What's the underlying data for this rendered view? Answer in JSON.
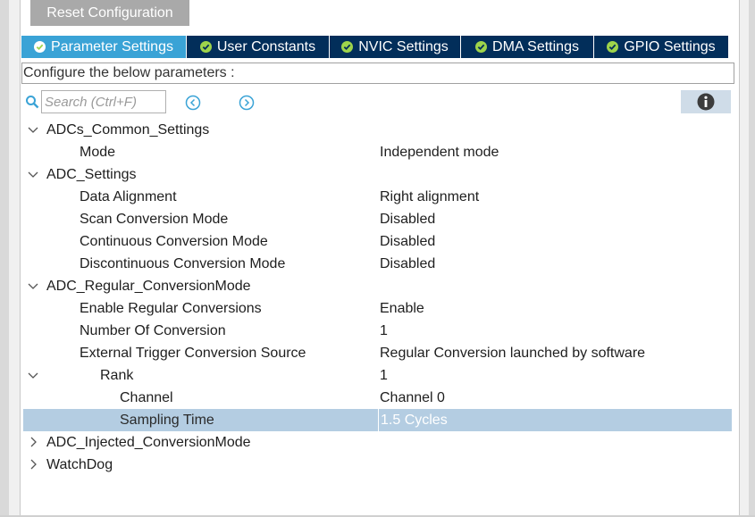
{
  "toolbar": {
    "reset_label": "Reset Configuration"
  },
  "tabs": [
    {
      "label": "Parameter Settings",
      "active": true
    },
    {
      "label": "User Constants",
      "active": false
    },
    {
      "label": "NVIC Settings",
      "active": false
    },
    {
      "label": "DMA Settings",
      "active": false
    },
    {
      "label": "GPIO Settings",
      "active": false
    }
  ],
  "configure_label": "Configure the below parameters :",
  "search": {
    "placeholder": "Search (Ctrl+F)"
  },
  "icons": {
    "search": "search-icon",
    "prev": "circle-chevron-left-icon",
    "next": "circle-chevron-right-icon",
    "info": "info-icon",
    "check": "check-circle-icon"
  },
  "tree": {
    "adc_common": {
      "label": "ADCs_Common_Settings",
      "mode_label": "Mode",
      "mode_value": "Independent mode"
    },
    "adc_settings": {
      "label": "ADC_Settings",
      "data_alignment_label": "Data Alignment",
      "data_alignment_value": "Right alignment",
      "scan_label": "Scan Conversion Mode",
      "scan_value": "Disabled",
      "continuous_label": "Continuous Conversion Mode",
      "continuous_value": "Disabled",
      "discontinuous_label": "Discontinuous Conversion Mode",
      "discontinuous_value": "Disabled"
    },
    "regular": {
      "label": "ADC_Regular_ConversionMode",
      "enable_label": "Enable Regular Conversions",
      "enable_value": "Enable",
      "number_label": "Number Of Conversion",
      "number_value": "1",
      "trigger_label": "External Trigger Conversion Source",
      "trigger_value": "Regular Conversion launched by software",
      "rank_label": "Rank",
      "rank_value": "1",
      "channel_label": "Channel",
      "channel_value": "Channel 0",
      "sampling_label": "Sampling Time",
      "sampling_value": "1.5 Cycles"
    },
    "injected": {
      "label": "ADC_Injected_ConversionMode"
    },
    "watchdog": {
      "label": "WatchDog"
    }
  },
  "colors": {
    "tab_bar": "#022e5a",
    "tab_active": "#3aa3d6",
    "check_green": "#9ed44b",
    "selected_row": "#b4cde2",
    "nav_icon": "#3aa3d6"
  }
}
